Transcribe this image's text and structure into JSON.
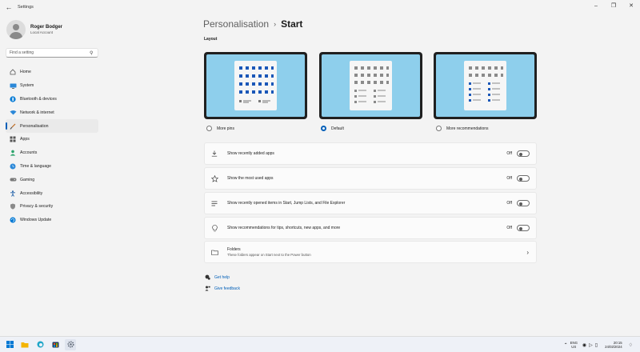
{
  "window": {
    "title": "Settings",
    "controls": [
      "minimize",
      "maximize",
      "close"
    ]
  },
  "profile": {
    "name": "Roger Bodger",
    "account_type": "Local Account"
  },
  "search": {
    "placeholder": "Find a setting"
  },
  "sidebar": {
    "items": [
      {
        "label": "Home",
        "icon": "home-icon",
        "active": false
      },
      {
        "label": "System",
        "icon": "system-icon",
        "active": false
      },
      {
        "label": "Bluetooth & devices",
        "icon": "bluetooth-icon",
        "active": false
      },
      {
        "label": "Network & internet",
        "icon": "wifi-icon",
        "active": false
      },
      {
        "label": "Personalisation",
        "icon": "brush-icon",
        "active": true
      },
      {
        "label": "Apps",
        "icon": "apps-icon",
        "active": false
      },
      {
        "label": "Accounts",
        "icon": "person-icon",
        "active": false
      },
      {
        "label": "Time & language",
        "icon": "globe-clock-icon",
        "active": false
      },
      {
        "label": "Gaming",
        "icon": "gamepad-icon",
        "active": false
      },
      {
        "label": "Accessibility",
        "icon": "accessibility-icon",
        "active": false
      },
      {
        "label": "Privacy & security",
        "icon": "shield-icon",
        "active": false
      },
      {
        "label": "Windows Update",
        "icon": "update-icon",
        "active": false
      }
    ]
  },
  "header": {
    "parent": "Personalisation",
    "current": "Start"
  },
  "layout": {
    "section_label": "Layout",
    "options": [
      {
        "label": "More pins",
        "checked": false
      },
      {
        "label": "Default",
        "checked": true
      },
      {
        "label": "More recommendations",
        "checked": false
      }
    ]
  },
  "settings": [
    {
      "label": "Show recently added apps",
      "state": "Off",
      "icon": "download-icon"
    },
    {
      "label": "Show the most used apps",
      "state": "Off",
      "icon": "star-icon"
    },
    {
      "label": "Show recently opened items in Start, Jump Lists, and File Explorer",
      "state": "Off",
      "icon": "list-icon"
    },
    {
      "label": "Show recommendations for tips, shortcuts, new apps, and more",
      "state": "Off",
      "icon": "lightbulb-icon"
    }
  ],
  "folders": {
    "title": "Folders",
    "subtitle": "These folders appear on Start next to the Power button"
  },
  "links": {
    "help": "Get help",
    "feedback": "Give feedback"
  },
  "taskbar": {
    "lang_line1": "ENG",
    "lang_line2": "US",
    "time": "20:15",
    "date": "24/02/2024"
  },
  "colors": {
    "accent": "#005fb8",
    "wallpaper": "#8ecfec"
  }
}
